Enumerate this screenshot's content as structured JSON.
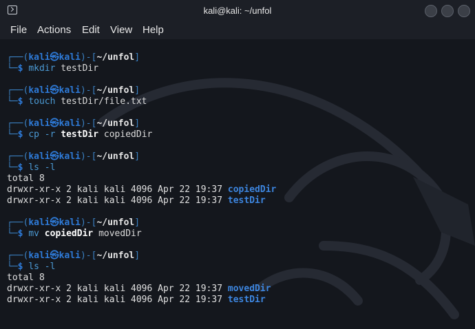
{
  "window": {
    "title": "kali@kali: ~/unfol"
  },
  "menu": [
    "File",
    "Actions",
    "Edit",
    "View",
    "Help"
  ],
  "prompt": {
    "top_left": "┌──(",
    "user": "kali",
    "at": "㉿",
    "host": "kali",
    "mid": ")-[",
    "path": "~/unfol",
    "end": "]",
    "bottom": "└─",
    "dollar": "$"
  },
  "blocks": [
    {
      "command": "mkdir",
      "args": [
        {
          "text": "testDir",
          "bold": false
        }
      ]
    },
    {
      "command": "touch",
      "args": [
        {
          "text": "testDir/file.txt",
          "bold": false
        }
      ]
    },
    {
      "command": "cp",
      "args": [
        {
          "text": "-r",
          "bold": false,
          "flag": true
        },
        {
          "text": "testDir",
          "bold": true
        },
        {
          "text": "copiedDir",
          "bold": false
        }
      ]
    },
    {
      "command": "ls",
      "args": [
        {
          "text": "-l",
          "bold": false,
          "flag": true
        }
      ],
      "output": [
        {
          "text": "total 8"
        },
        {
          "text": "drwxr-xr-x 2 kali kali 4096 Apr 22 19:37 ",
          "dir": "copiedDir"
        },
        {
          "text": "drwxr-xr-x 2 kali kali 4096 Apr 22 19:37 ",
          "dir": "testDir"
        }
      ]
    },
    {
      "command": "mv",
      "args": [
        {
          "text": "copiedDir",
          "bold": true
        },
        {
          "text": "movedDir",
          "bold": false
        }
      ]
    },
    {
      "command": "ls",
      "args": [
        {
          "text": "-l",
          "bold": false,
          "flag": true
        }
      ],
      "output": [
        {
          "text": "total 8"
        },
        {
          "text": "drwxr-xr-x 2 kali kali 4096 Apr 22 19:37 ",
          "dir": "movedDir"
        },
        {
          "text": "drwxr-xr-x 2 kali kali 4096 Apr 22 19:37 ",
          "dir": "testDir"
        }
      ]
    }
  ],
  "colors": {
    "background": "#14171d",
    "prompt_frame": "#3b82c4",
    "user_host": "#2e7bd9",
    "command": "#4c9bd6",
    "directory": "#3d86e0"
  }
}
